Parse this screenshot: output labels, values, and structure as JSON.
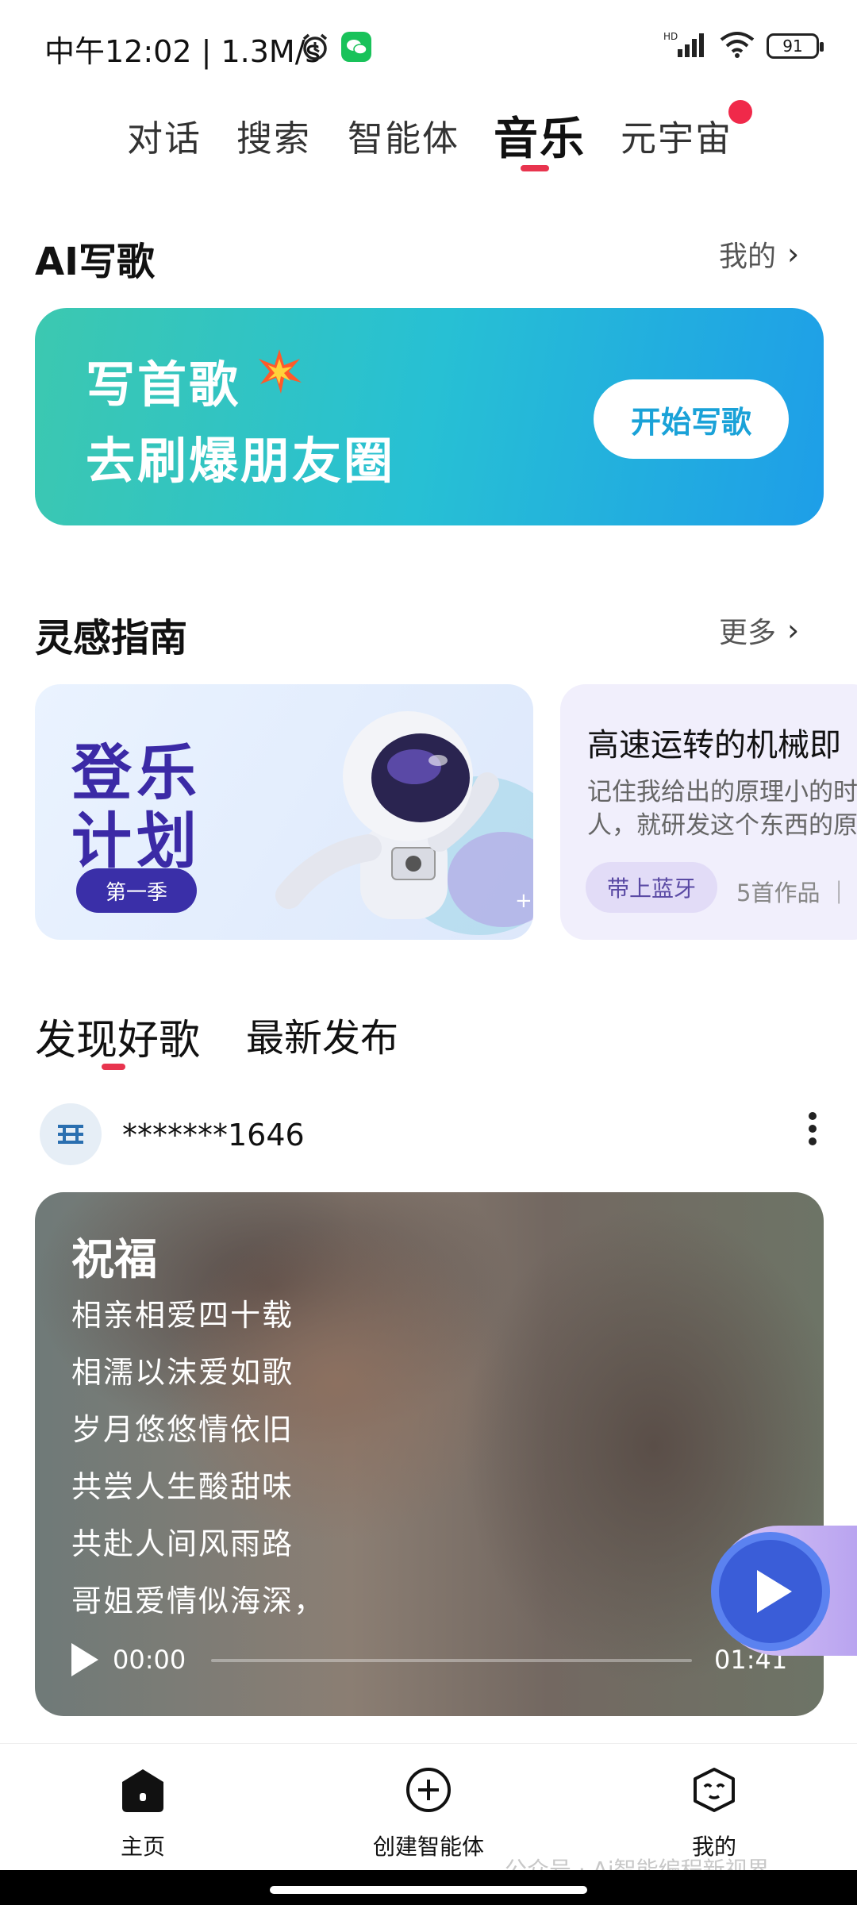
{
  "status_bar": {
    "time": "中午12:02 | 1.3M/s",
    "network": "HD",
    "battery": "91",
    "icons": [
      "alarm-icon",
      "wechat-icon",
      "signal-icon",
      "wifi-icon",
      "battery-icon"
    ]
  },
  "top_tabs": [
    {
      "label": "对话"
    },
    {
      "label": "搜索"
    },
    {
      "label": "智能体"
    },
    {
      "label": "音乐",
      "active": true
    },
    {
      "label": "元宇宙",
      "badge": true
    }
  ],
  "ai_song": {
    "title": "AI写歌",
    "more": "我的",
    "banner": {
      "line1": "写首歌",
      "line2": "去刷爆朋友圈",
      "button": "开始写歌"
    }
  },
  "inspiration": {
    "title": "灵感指南",
    "more": "更多",
    "card1": {
      "line1": "登乐",
      "line2": "计划",
      "season": "第一季"
    },
    "card2": {
      "title": "高速运转的机械即",
      "desc1": "记住我给出的原理小的时",
      "desc2": "人，就研发这个东西的原",
      "tag": "带上蓝牙",
      "count": "5首作品 ｜"
    }
  },
  "discover": {
    "tabs": [
      {
        "label": "发现好歌",
        "active": true
      },
      {
        "label": "最新发布"
      }
    ],
    "user": {
      "name": "*******1646"
    },
    "song": {
      "title": "祝福",
      "lyrics": [
        "相亲相爱四十载",
        "相濡以沫爱如歌",
        "岁月悠悠情依旧",
        "共尝人生酸甜味",
        "共赴人间风雨路",
        "哥姐爱情似海深，"
      ],
      "current_time": "00:00",
      "duration": "01:41",
      "progress": 0
    }
  },
  "bottom_nav": [
    {
      "label": "主页",
      "icon": "home-icon"
    },
    {
      "label": "创建智能体",
      "icon": "plus-circle-icon"
    },
    {
      "label": "我的",
      "icon": "profile-face-icon"
    }
  ],
  "watermark": "公众号 · Ai智能编程新视界",
  "colors": {
    "accent_red": "#e8344e",
    "banner_start": "#3cc8b0",
    "banner_end": "#1e9ee8",
    "play_blue": "#3a5dd8"
  }
}
